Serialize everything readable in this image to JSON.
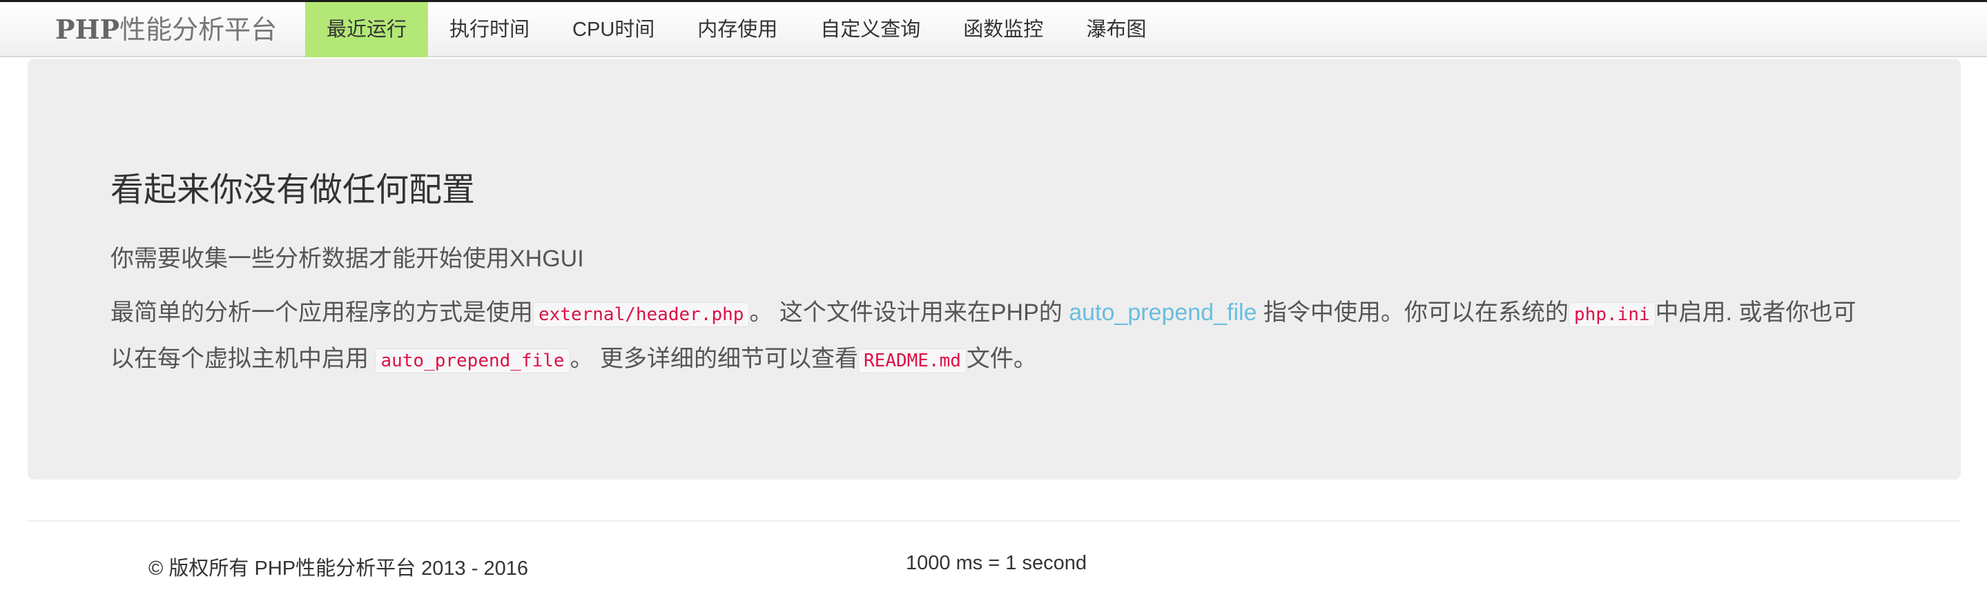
{
  "brand": {
    "strong": "PHP",
    "rest": "性能分析平台"
  },
  "nav": {
    "items": [
      {
        "label": "最近运行",
        "active": true
      },
      {
        "label": "执行时间"
      },
      {
        "label": "CPU时间"
      },
      {
        "label": "内存使用"
      },
      {
        "label": "自定义查询"
      },
      {
        "label": "函数监控"
      },
      {
        "label": "瀑布图"
      }
    ]
  },
  "hero": {
    "title": "看起来你没有做任何配置",
    "intro": "你需要收集一些分析数据才能开始使用XHGUI",
    "body": {
      "t1": "最简单的分析一个应用程序的方式是使用",
      "code1": "external/header.php",
      "t2": "。 这个文件设计用来在PHP的 ",
      "link": "auto_prepend_file",
      "t3": " 指令中使用。你可以在系统的",
      "code2": "php.ini",
      "t4": "中启用. 或者你也可以在每个虚拟主机中启用 ",
      "code3": "auto_prepend_file",
      "t5": "。 更多详细的细节可以查看",
      "code4": "README.md",
      "t6": "文件。"
    }
  },
  "footer": {
    "copyright": "© 版权所有 PHP性能分析平台 2013 - 2016",
    "units": "1000 ms = 1 second"
  }
}
